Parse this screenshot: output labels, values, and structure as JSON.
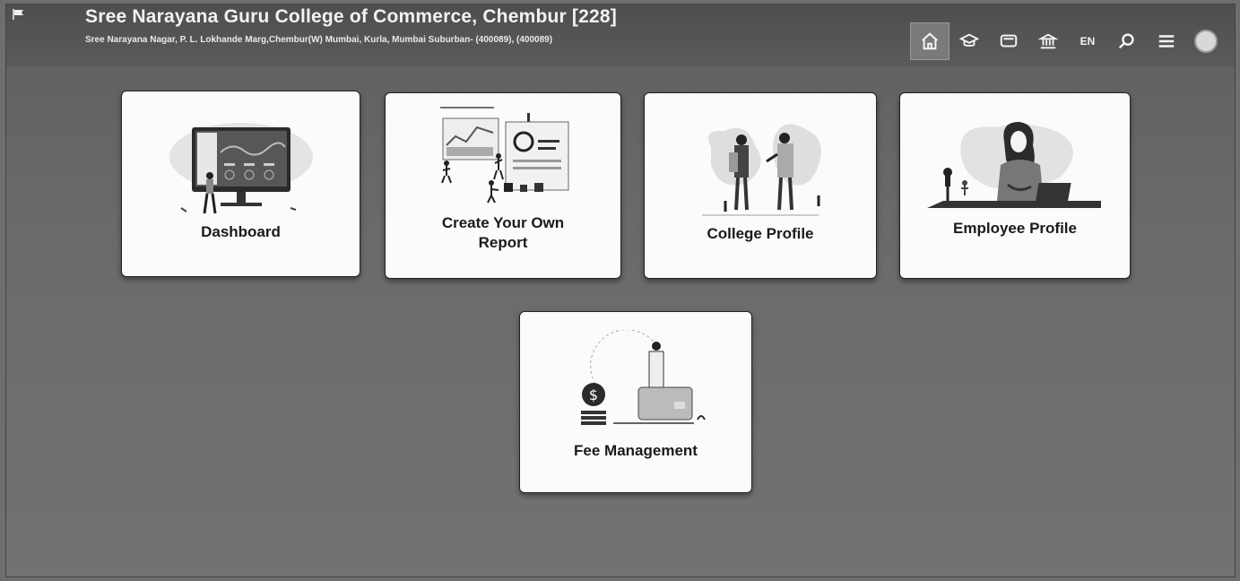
{
  "header": {
    "title": "Sree Narayana Guru College of Commerce, Chembur [228]",
    "address": "Sree Narayana Nagar, P. L. Lokhande Marg,Chembur(W) Mumbai, Kurla, Mumbai Suburban- (400089), (400089)",
    "nav": [
      {
        "icon": "home-icon"
      },
      {
        "icon": "graduation-cap-icon"
      },
      {
        "icon": "monitor-icon"
      },
      {
        "icon": "institution-icon"
      },
      {
        "label": "EN"
      },
      {
        "icon": "search-icon"
      },
      {
        "icon": "menu-icon"
      },
      {
        "icon": "user-avatar-icon"
      }
    ]
  },
  "cards": {
    "dashboard": "Dashboard",
    "report_line1": "Create Your Own",
    "report_line2": "Report",
    "college_profile": "College Profile",
    "employee_profile": "Employee Profile",
    "fee_management": "Fee Management"
  }
}
